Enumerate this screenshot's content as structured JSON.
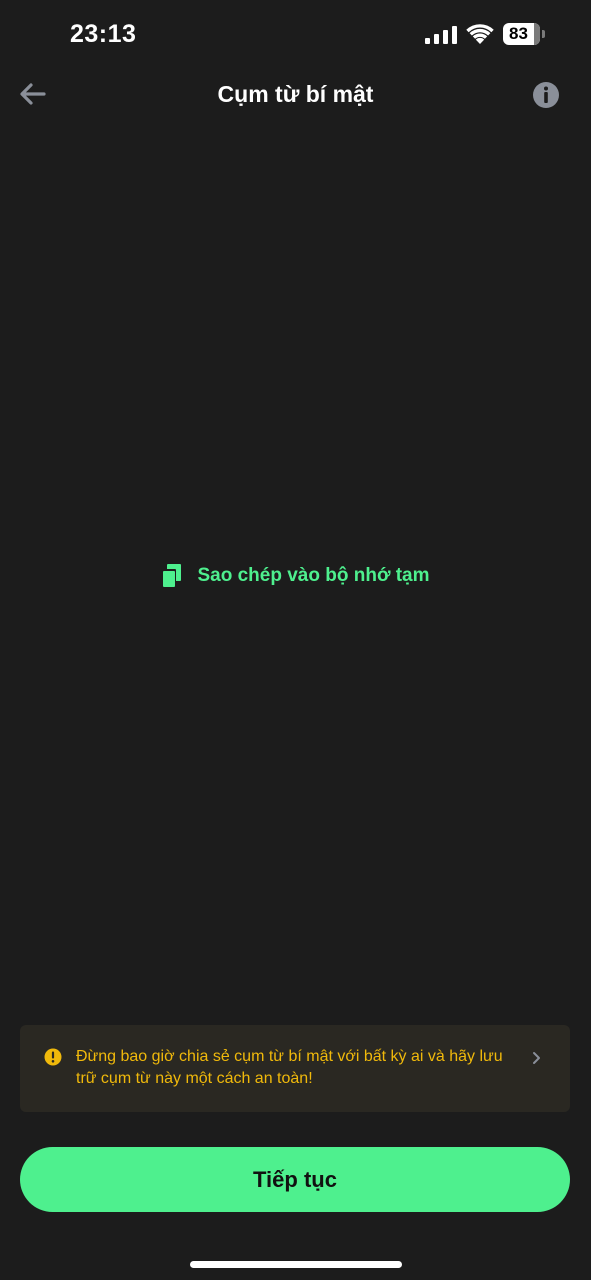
{
  "status_bar": {
    "time": "23:13",
    "battery_level": "83",
    "icons": [
      "signal-icon",
      "wifi-icon",
      "battery-icon"
    ]
  },
  "header": {
    "title": "Cụm từ bí mật",
    "back_icon": "arrow-left-icon",
    "info_icon": "info-icon"
  },
  "copy": {
    "label": "Sao chép vào bộ nhớ tạm",
    "icon": "copy-icon"
  },
  "warning": {
    "text": "Đừng bao giờ chia sẻ cụm từ bí mật với bất kỳ ai và hãy lưu trữ cụm từ này một cách an toàn!",
    "icon": "warning-icon",
    "chevron_icon": "chevron-right-icon"
  },
  "continue_button": {
    "label": "Tiếp tục"
  },
  "colors": {
    "background": "#1c1c1c",
    "accent_green": "#4ef08e",
    "warning_yellow": "#f0b90b",
    "warning_bg": "#2a2822"
  }
}
